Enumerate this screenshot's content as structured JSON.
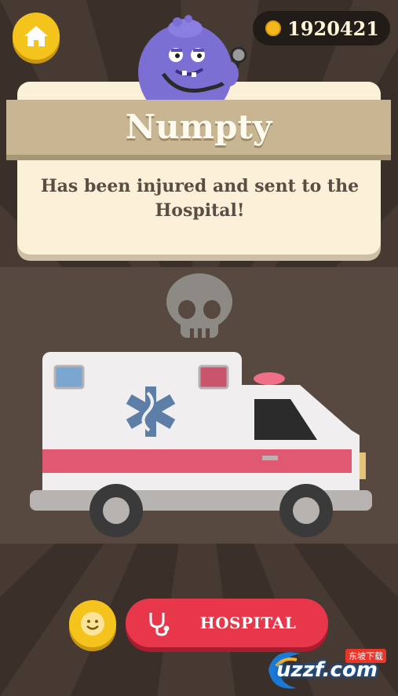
{
  "header": {
    "home_icon": "home-icon",
    "coins": "1920421",
    "coin_icon": "coin-icon"
  },
  "popup": {
    "character_name": "Numpty",
    "message": "Has been injured and sent to the Hospital!"
  },
  "scene": {
    "skull_icon": "skull-icon",
    "vehicle": "ambulance"
  },
  "footer": {
    "smile_icon": "smiley-face-icon",
    "hospital_button_label": "HOSPITAL",
    "hospital_icon": "stethoscope-icon"
  },
  "watermark": {
    "text": "uzzf.com",
    "cn_text": "东坡下载"
  },
  "colors": {
    "background": "#3a3029",
    "band": "#57493f",
    "accent_yellow": "#f4c41c",
    "accent_red": "#e8364a",
    "card": "#fbf1d9",
    "ribbon": "#c8b692"
  }
}
